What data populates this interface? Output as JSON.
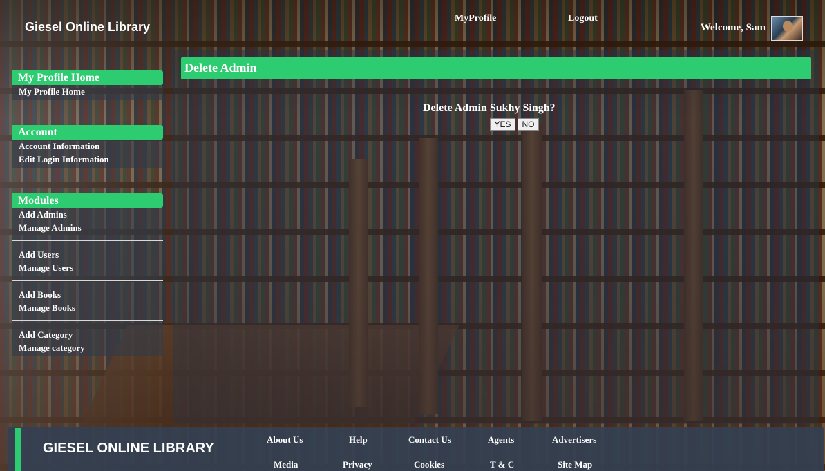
{
  "header": {
    "brand": "Giesel Online Library",
    "nav": [
      "MyProfile",
      "Logout"
    ],
    "welcome": "Welcome, Sam"
  },
  "sidebar": {
    "groups": [
      {
        "title": "My Profile Home",
        "items": [
          "My Profile Home"
        ]
      },
      {
        "title": "Account",
        "items": [
          "Account Information",
          "Edit Login Information"
        ]
      },
      {
        "title": "Modules",
        "items": [
          "Add Admins",
          "Manage Admins",
          "Add Users",
          "Manage Users",
          "Add Books",
          "Manage Books",
          "Add Category",
          "Manage category"
        ]
      }
    ]
  },
  "main": {
    "title": "Delete Admin",
    "confirm_text": "Delete Admin Sukhy Singh?",
    "yes_label": "YES",
    "no_label": "NO"
  },
  "footer": {
    "title": "GIESEL ONLINE LIBRARY",
    "links_row1": [
      "About Us",
      "Help",
      "Contact Us",
      "Agents",
      "Advertisers"
    ],
    "links_row2": [
      "Media",
      "Privacy",
      "Cookies",
      "T & C",
      "Site Map"
    ]
  },
  "colors": {
    "accent": "#2ecc71",
    "panel": "#323a48"
  }
}
